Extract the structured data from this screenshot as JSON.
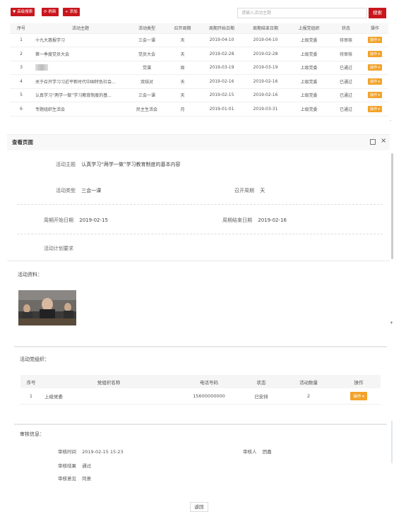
{
  "toolbar": {
    "advanced_search": "高级搜索",
    "refresh": "刷新",
    "add": "添加",
    "search_placeholder": "请输入活动主题",
    "search_button": "搜索"
  },
  "list": {
    "headers": [
      "序号",
      "活动主题",
      "活动类型",
      "召开周期",
      "周期开始日期",
      "周期结束日期",
      "上报党组织",
      "状态",
      "操作"
    ],
    "rows": [
      {
        "no": "1",
        "topic": "十九大惠报学习",
        "type": "三会一课",
        "cycle": "天",
        "start": "2019-04-10",
        "end": "2019-04-10",
        "org": "上级党委",
        "status": "待审核",
        "op": "操作"
      },
      {
        "no": "2",
        "topic": "第一季度党员大会",
        "type": "党员大会",
        "cycle": "天",
        "start": "2019-02-28",
        "end": "2019-02-28",
        "org": "上级党委",
        "status": "待审核",
        "op": "操作"
      },
      {
        "no": "3",
        "topic": "",
        "type": "党课",
        "cycle": "周",
        "start": "2019-03-19",
        "end": "2019-03-19",
        "org": "上级党委",
        "status": "已通过",
        "op": "操作"
      },
      {
        "no": "4",
        "topic": "关于召开学习习近平新时代中国特色社会...",
        "type": "双结对",
        "cycle": "天",
        "start": "2019-02-16",
        "end": "2019-02-16",
        "org": "上级党委",
        "status": "已通过",
        "op": "操作"
      },
      {
        "no": "5",
        "topic": "认真学习“两学一做”学习教育制度的基...",
        "type": "三会一课",
        "cycle": "天",
        "start": "2019-02-15",
        "end": "2019-02-16",
        "org": "上级党委",
        "status": "已通过",
        "op": "操作"
      },
      {
        "no": "6",
        "topic": "专题组织生活会",
        "type": "民主生活会",
        "cycle": "月",
        "start": "2019-01-01",
        "end": "2019-03-31",
        "org": "上级党委",
        "status": "已通过",
        "op": "操作"
      }
    ]
  },
  "dialog": {
    "title": "查看页面",
    "topic_label": "活动主题",
    "topic_value": "认真学习“两学一做”学习教育制度的基本内容",
    "type_label": "活动类型",
    "type_value": "三会一课",
    "cycle_label": "召开周期",
    "cycle_value": "天",
    "start_label": "周期开始日期",
    "start_value": "2019-02-15",
    "end_label": "周期结束日期",
    "end_value": "2019-02-16",
    "plan_label": "活动计划要求",
    "materials_label": "活动资料："
  },
  "org_section": {
    "title": "活动党组织：",
    "headers": [
      "序号",
      "党组织名称",
      "电话号码",
      "状态",
      "活动数量",
      "操作"
    ],
    "rows": [
      {
        "no": "1",
        "name": "上级党委",
        "phone": "15600000000",
        "status": "已安排",
        "count": "2",
        "op": "操作"
      }
    ]
  },
  "review": {
    "title": "审核信息：",
    "time_label": "审核时间",
    "time_value": "2019-02-15 15:23",
    "reviewer_label": "审核人",
    "reviewer_value": "团嘉",
    "result_label": "审核结果",
    "result_value": "通过",
    "opinion_label": "审核意见",
    "opinion_value": "同意"
  },
  "back_button": "返回",
  "colors": {
    "primary": "#c9161d",
    "operation": "#f2a32b"
  }
}
